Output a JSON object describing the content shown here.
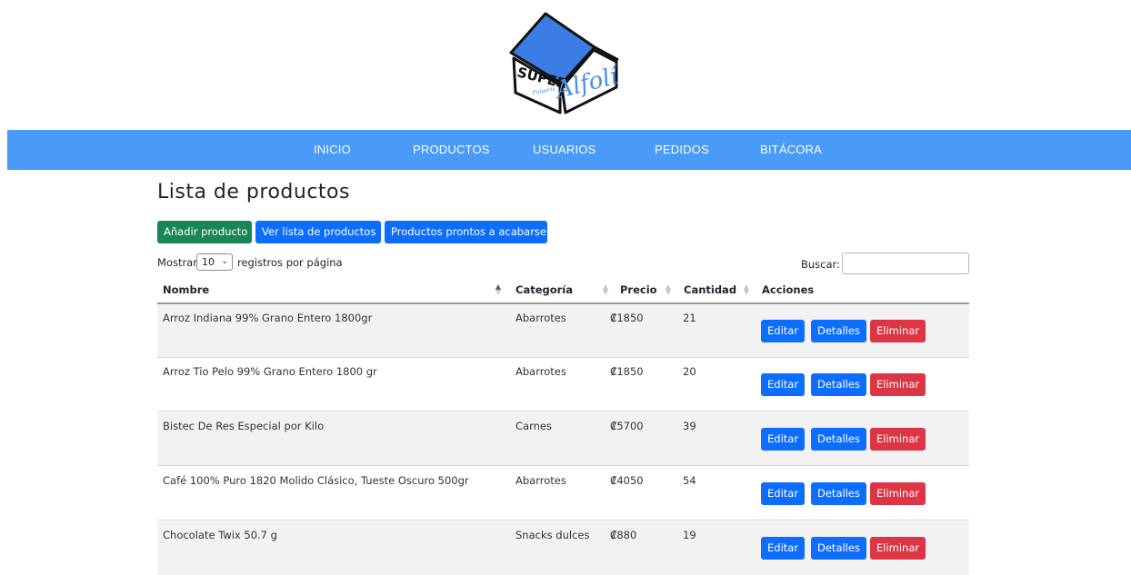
{
  "header": {
    "logo_text_super": "SUPER",
    "logo_text_script": "Alfolí",
    "logo_text_small": "Pulpería"
  },
  "nav": {
    "items": [
      {
        "label": "INICIO"
      },
      {
        "label": "PRODUCTOS"
      },
      {
        "label": "USUARIOS"
      },
      {
        "label": "PEDIDOS"
      },
      {
        "label": "BITÁCORA"
      }
    ]
  },
  "main": {
    "title": "Lista de productos",
    "buttons": {
      "add": "Añadir producto",
      "view_list": "Ver lista de productos",
      "low_stock": "Productos prontos a acabarse"
    },
    "length_menu": {
      "prefix": "Mostrar",
      "selected": "10",
      "suffix": "registros por página"
    },
    "search": {
      "label": "Buscar:",
      "value": ""
    }
  },
  "table": {
    "columns": [
      "Nombre",
      "Categoría",
      "Precio",
      "Cantidad",
      "Acciones"
    ],
    "action_labels": {
      "edit": "Editar",
      "details": "Detalles",
      "delete": "Eliminar"
    },
    "rows": [
      {
        "name": "Arroz Indiana 99% Grano Entero 1800gr",
        "category": "Abarrotes",
        "price": "₡1850",
        "quantity": "21"
      },
      {
        "name": "Arroz Tio Pelo 99% Grano Entero 1800 gr",
        "category": "Abarrotes",
        "price": "₡1850",
        "quantity": "20"
      },
      {
        "name": "Bistec De Res Especial por Kilo",
        "category": "Carnes",
        "price": "₡5700",
        "quantity": "39"
      },
      {
        "name": "Café 100% Puro 1820 Molido Clásico, Tueste Oscuro 500gr",
        "category": "Abarrotes",
        "price": "₡4050",
        "quantity": "54"
      },
      {
        "name": "Chocolate Twix 50.7 g",
        "category": "Snacks dulces",
        "price": "₡880",
        "quantity": "19"
      }
    ]
  },
  "colors": {
    "nav_bg": "#4a9af7",
    "btn_green": "#198754",
    "btn_blue": "#0d6efd",
    "btn_red": "#dc3545",
    "row_stripe": "#f2f2f2"
  }
}
